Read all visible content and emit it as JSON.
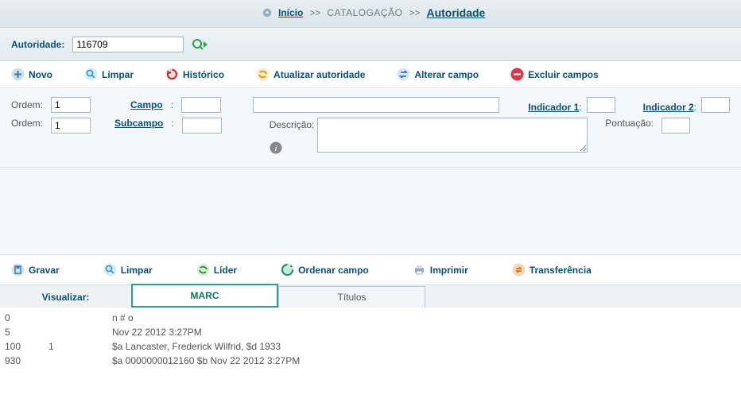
{
  "breadcrumb": {
    "home": "Início",
    "catalog": "CATALOGAÇÃO",
    "current": "Autoridade",
    "sep": ">>"
  },
  "search": {
    "label": "Autoridade:",
    "value": "116709"
  },
  "toolbar1": {
    "novo": "Novo",
    "limpar": "Limpar",
    "historico": "Histórico",
    "atualizar": "Atualizar autoridade",
    "alterar": "Alterar campo",
    "excluir": "Excluir campos"
  },
  "form": {
    "ordem_label": "Ordem:",
    "ordem1_value": "1",
    "campo_label": "Campo",
    "campo_colon": ":",
    "campo_value": "",
    "big_value": "",
    "ind1_label": "Indicador 1",
    "ind1_colon": ":",
    "ind2_label": "Indicador 2",
    "ind2_colon": ":",
    "ind1_value": "",
    "ind2_value": "",
    "ordem2_value": "1",
    "subcampo_label": "Subcampo",
    "subcampo_colon": ":",
    "subcampo_value": "",
    "descricao_label": "Descrição:",
    "descricao_value": "",
    "pontuacao_label": "Pontuação:",
    "pontuacao_value": ""
  },
  "toolbar2": {
    "gravar": "Gravar",
    "limpar": "Limpar",
    "lider": "Líder",
    "ordenar": "Ordenar campo",
    "imprimir": "Imprimir",
    "transf": "Transferência"
  },
  "view": {
    "label": "Visualizar:",
    "tab_marc": "MARC",
    "tab_titulos": "Títulos"
  },
  "marc": [
    {
      "tag": "0",
      "ind": "",
      "val": "n # o"
    },
    {
      "tag": "5",
      "ind": "",
      "val": "Nov 22 2012 3:27PM"
    },
    {
      "tag": "100",
      "ind": "1",
      "val": "$a Lancaster, Frederick Wilfrid, $d 1933"
    },
    {
      "tag": "930",
      "ind": "",
      "val": "$a 0000000012160 $b Nov 22 2012 3:27PM"
    }
  ],
  "colors": {
    "link": "#0a4f7a",
    "teal": "#2aa090"
  }
}
